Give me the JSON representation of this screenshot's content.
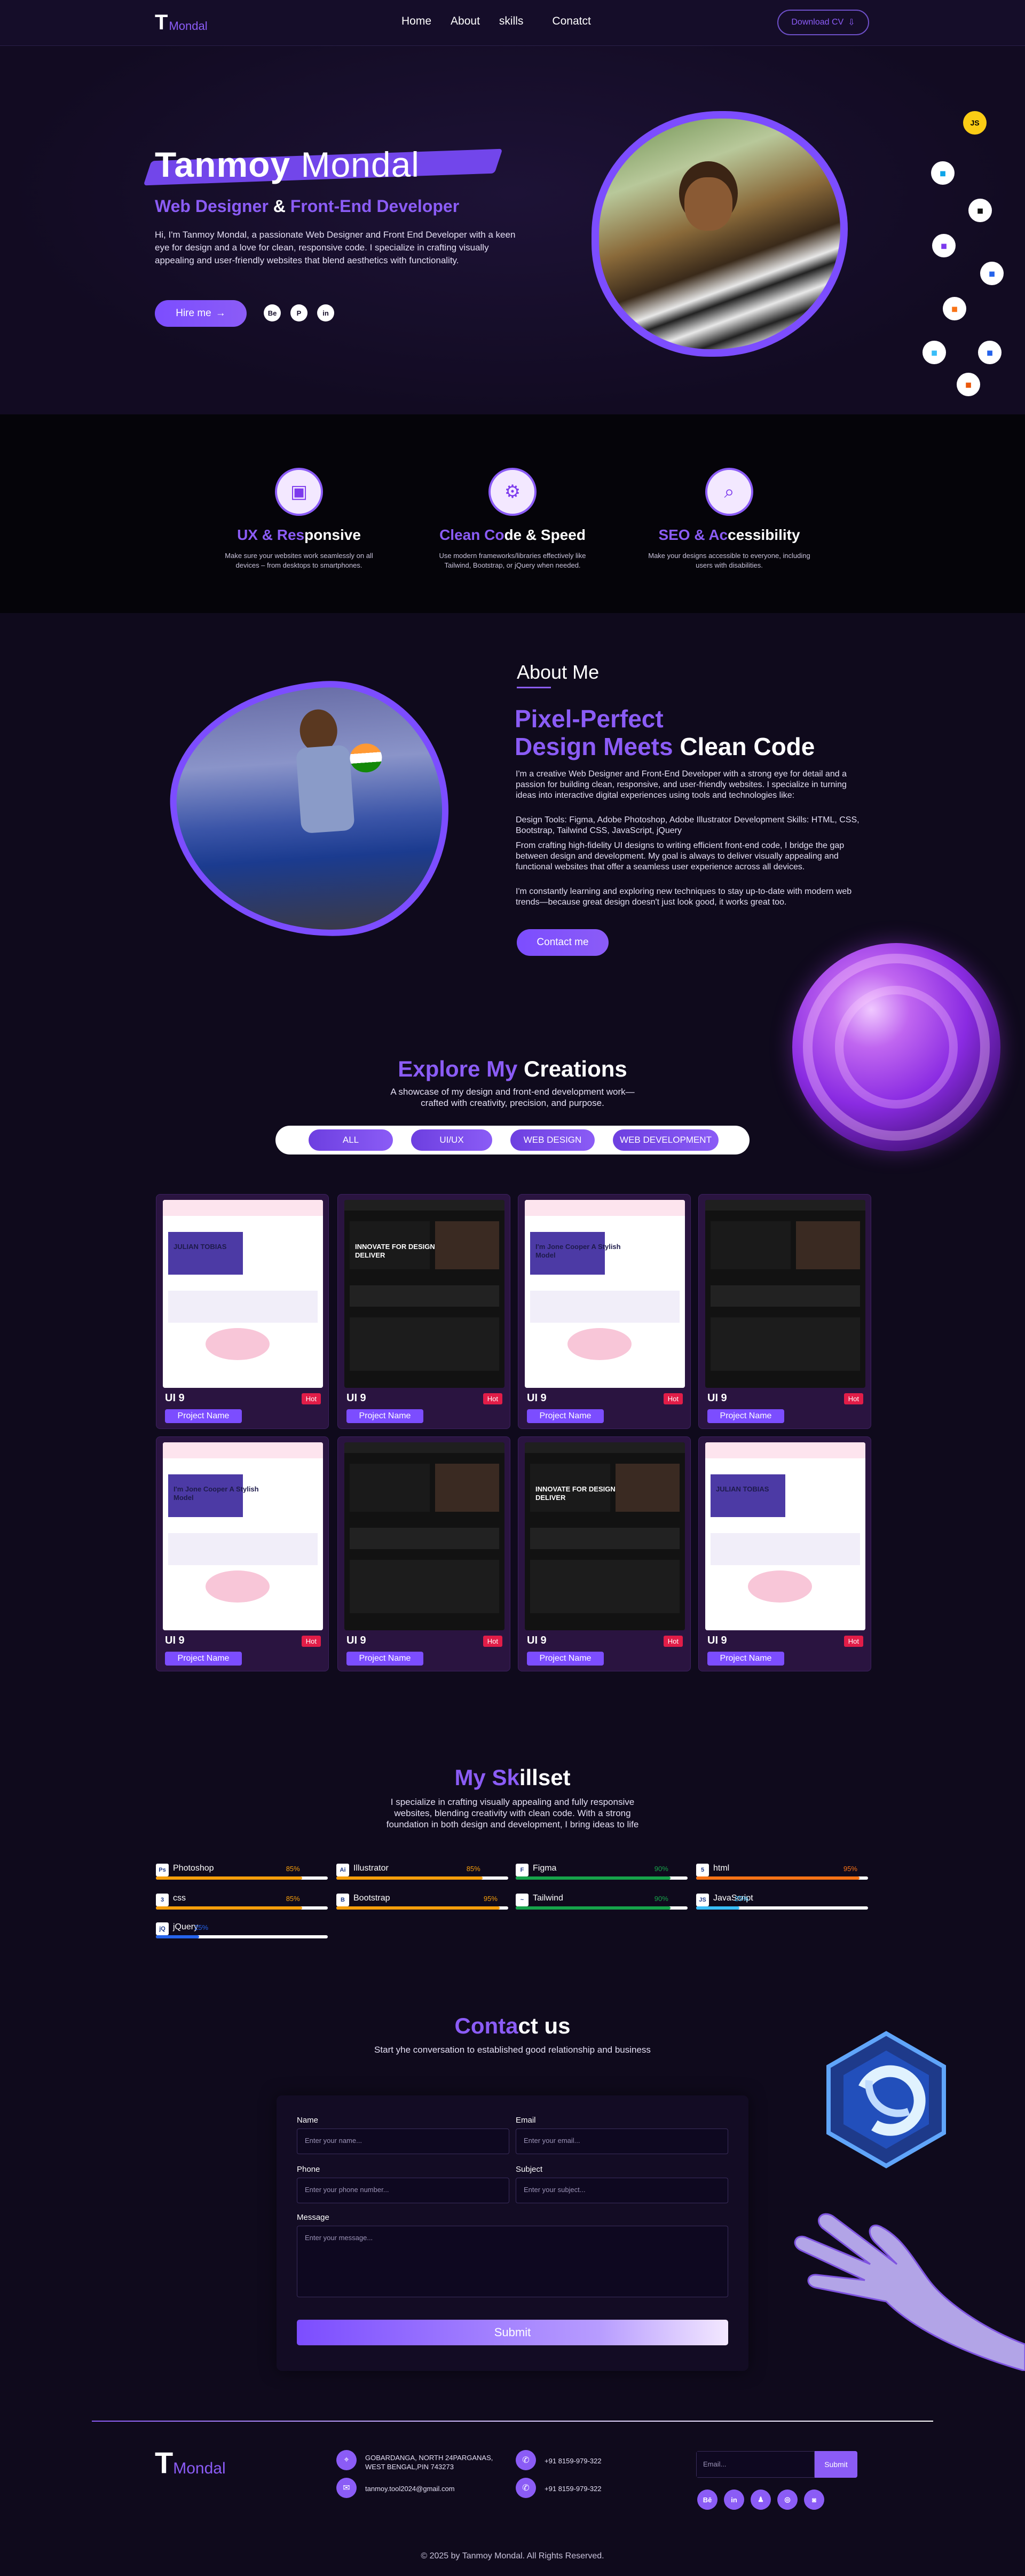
{
  "nav": {
    "logo_t": "T",
    "logo_m": "Mondal",
    "links": [
      "Home",
      "About",
      "skills",
      "Conatct"
    ],
    "download": "Download CV",
    "download_icon": "⇩"
  },
  "hero": {
    "first": "Tanmoy",
    "last": "Mondal",
    "role_a": "Web Designer",
    "role_amp": "&",
    "role_b": "Front-End Developer",
    "intro": "Hi, I'm Tanmoy Mondal, a passionate Web Designer and Front End Developer with a keen eye for design and a love for clean, responsive code. I specialize in crafting visually appealing and user-friendly websites that blend aesthetics with functionality.",
    "hire": "Hire me",
    "hire_icon": "→",
    "social": [
      "Be",
      "P",
      "in"
    ],
    "tech_js": "JS"
  },
  "features": [
    {
      "icon": "responsive-icon",
      "glyph": "▣",
      "title_a": "UX & Res",
      "title_b": "ponsive",
      "desc": "Make sure your websites work seamlessly on all devices – from desktops to smartphones."
    },
    {
      "icon": "code-speed-icon",
      "glyph": "⚙",
      "title_a": "Clean Co",
      "title_b": "de & Speed",
      "desc": "Use modern frameworks/libraries effectively like Tailwind, Bootstrap, or jQuery when needed."
    },
    {
      "icon": "seo-icon",
      "glyph": "⌕",
      "title_a": "SEO & Ac",
      "title_b": "cessibility",
      "desc": "Make your designs accessible to everyone, including users with disabilities."
    }
  ],
  "about": {
    "heading": "About Me",
    "title_l1": "Pixel-Perfect",
    "title_l2a": "Design Meets",
    "title_l2b": "Clean Code",
    "p1": "I'm a creative Web Designer and Front-End Developer with a strong eye for detail and a passion for building clean, responsive, and user-friendly websites. I specialize in turning ideas into interactive digital experiences using tools and technologies like:",
    "p2": "Design Tools: Figma, Adobe Photoshop, Adobe Illustrator Development Skills: HTML, CSS, Bootstrap, Tailwind CSS, JavaScript, jQuery",
    "p3": "From crafting high-fidelity UI designs to writing efficient front-end code, I bridge the gap between design and development. My goal is always to deliver visually appealing and functional websites that offer a seamless user experience across all devices.",
    "p4": "I'm constantly learning and exploring new techniques to stay up-to-date with modern web trends—because great design doesn't just look good, it works great too.",
    "contact": "Contact me"
  },
  "projects": {
    "title_a": "Explore My",
    "title_b": "Creations",
    "sub": "A showcase of my design and front-end development work—crafted with creativity, precision, and purpose.",
    "filters": [
      "ALL",
      "UI/UX",
      "WEB DESIGN",
      "WEB DEVELOPMENT"
    ],
    "cards": [
      {
        "title": "UI 9",
        "badge": "Hot",
        "button": "Project Name",
        "style": "light",
        "hero_text": "JULIAN TOBIAS"
      },
      {
        "title": "UI 9",
        "badge": "Hot",
        "button": "Project Name",
        "style": "dark",
        "hero_text": "INNOVATE FOR DESIGN DELIVER"
      },
      {
        "title": "UI 9",
        "badge": "Hot",
        "button": "Project Name",
        "style": "light",
        "hero_text": "I'm Jone Cooper A Stylish Model"
      },
      {
        "title": "UI 9",
        "badge": "Hot",
        "button": "Project Name",
        "style": "dark",
        "hero_text": ""
      },
      {
        "title": "UI 9",
        "badge": "Hot",
        "button": "Project Name",
        "style": "light",
        "hero_text": "I'm Jone Cooper A Stylish Model"
      },
      {
        "title": "UI 9",
        "badge": "Hot",
        "button": "Project Name",
        "style": "dark",
        "hero_text": ""
      },
      {
        "title": "UI 9",
        "badge": "Hot",
        "button": "Project Name",
        "style": "dark",
        "hero_text": "INNOVATE FOR DESIGN DELIVER"
      },
      {
        "title": "UI 9",
        "badge": "Hot",
        "button": "Project Name",
        "style": "light",
        "hero_text": "JULIAN TOBIAS"
      }
    ]
  },
  "skills": {
    "title_a": "My Sk",
    "title_b": "illset",
    "sub": "I specialize in crafting visually appealing and fully responsive websites, blending creativity with clean code. With a strong foundation in both design and development, I bring ideas to life",
    "items": [
      {
        "name": "Photoshop",
        "pct": "85%",
        "value": 0.85,
        "color": "#f59e0b",
        "icon": "Ps"
      },
      {
        "name": "Illustrator",
        "pct": "85%",
        "value": 0.85,
        "color": "#f59e0b",
        "icon": "Ai"
      },
      {
        "name": "Figma",
        "pct": "90%",
        "value": 0.9,
        "color": "#16a34a",
        "icon": "F"
      },
      {
        "name": "html",
        "pct": "95%",
        "value": 0.95,
        "color": "#f97316",
        "icon": "5"
      },
      {
        "name": "css",
        "pct": "85%",
        "value": 0.85,
        "color": "#f59e0b",
        "icon": "3"
      },
      {
        "name": "Bootstrap",
        "pct": "95%",
        "value": 0.95,
        "color": "#f59e0b",
        "icon": "B"
      },
      {
        "name": "Tailwind",
        "pct": "90%",
        "value": 0.9,
        "color": "#16a34a",
        "icon": "~"
      },
      {
        "name": "JavaScript",
        "pct": "25%",
        "value": 0.25,
        "color": "#38bdf8",
        "icon": "JS"
      },
      {
        "name": "jQuery",
        "pct": "25%",
        "value": 0.25,
        "color": "#2563eb",
        "icon": "jQ"
      }
    ]
  },
  "contact": {
    "title_a": "Conta",
    "title_b": "ct us",
    "sub": "Start yhe conversation to established good relationship and business",
    "name_label": "Name",
    "name_ph": "Enter your name...",
    "email_label": "Email",
    "email_ph": "Enter your email...",
    "phone_label": "Phone",
    "phone_ph": "Enter your phone number...",
    "subject_label": "Subject",
    "subject_ph": "Enter your subject...",
    "message_label": "Message",
    "message_ph": "Enter your message...",
    "submit": "Submit"
  },
  "footer": {
    "logo_t": "T",
    "logo_m": "Mondal",
    "address": "GOBARDANGA, NORTH 24PARGANAS, WEST BENGAL,PIN 743273",
    "email": "tanmoy.tool2024@gmail.com",
    "phone1": "+91 8159-979-322",
    "phone2": "+91 8159-979-322",
    "newsletter_ph": "Email...",
    "newsletter_btn": "Submit",
    "social": [
      "Bē",
      "in",
      "♟",
      "◎",
      "◙"
    ],
    "copyright": "© 2025 by Tanmoy Mondal. All Rights Reserved."
  }
}
